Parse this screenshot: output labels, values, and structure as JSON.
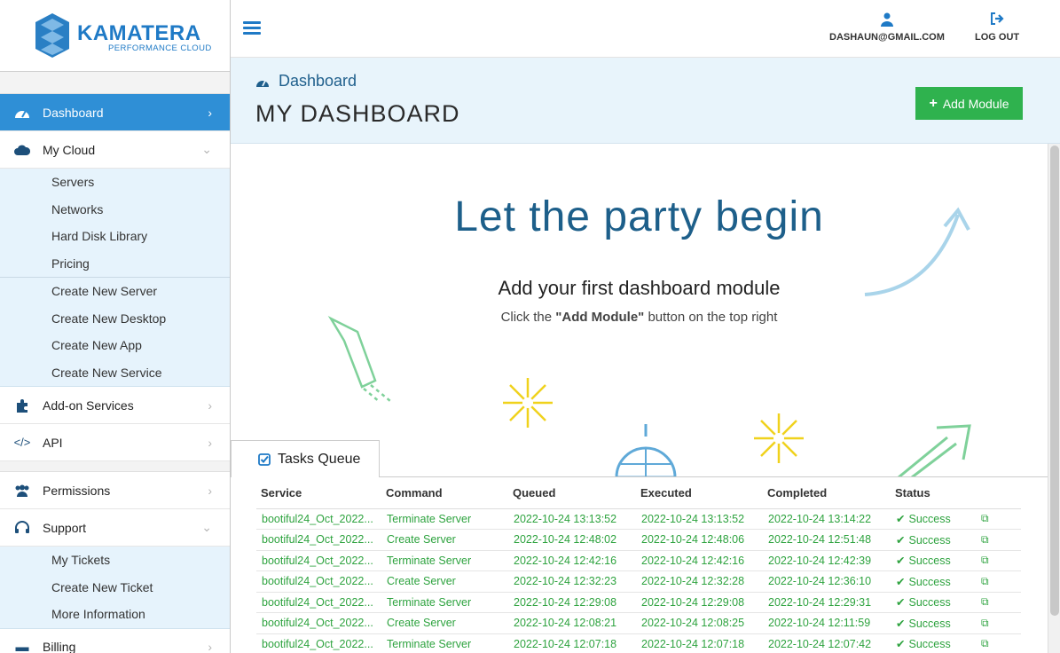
{
  "brand": {
    "name": "KAMATERA",
    "tagline": "PERFORMANCE CLOUD"
  },
  "topbar": {
    "user_email": "DASHAUN@GMAIL.COM",
    "logout_label": "LOG OUT"
  },
  "sidebar": {
    "dashboard": "Dashboard",
    "my_cloud": "My Cloud",
    "my_cloud_items": [
      "Servers",
      "Networks",
      "Hard Disk Library",
      "Pricing"
    ],
    "create_items": [
      "Create New Server",
      "Create New Desktop",
      "Create New App",
      "Create New Service"
    ],
    "addon": "Add-on Services",
    "api": "API",
    "permissions": "Permissions",
    "support": "Support",
    "support_items": [
      "My Tickets",
      "Create New Ticket",
      "More Information"
    ],
    "billing": "Billing"
  },
  "header": {
    "breadcrumb": "Dashboard",
    "title": "MY DASHBOARD",
    "add_module": "Add Module"
  },
  "hero": {
    "title": "Let the party begin",
    "subtitle": "Add your first dashboard module",
    "hint_pre": "Click the ",
    "hint_bold": "\"Add Module\"",
    "hint_post": " button on the top right"
  },
  "tasks": {
    "tab_label": "Tasks Queue",
    "columns": [
      "Service",
      "Command",
      "Queued",
      "Executed",
      "Completed",
      "Status"
    ],
    "rows": [
      [
        "bootiful24_Oct_2022...",
        "Terminate Server",
        "2022-10-24 13:13:52",
        "2022-10-24 13:13:52",
        "2022-10-24 13:14:22",
        "Success"
      ],
      [
        "bootiful24_Oct_2022...",
        "Create Server",
        "2022-10-24 12:48:02",
        "2022-10-24 12:48:06",
        "2022-10-24 12:51:48",
        "Success"
      ],
      [
        "bootiful24_Oct_2022...",
        "Terminate Server",
        "2022-10-24 12:42:16",
        "2022-10-24 12:42:16",
        "2022-10-24 12:42:39",
        "Success"
      ],
      [
        "bootiful24_Oct_2022...",
        "Create Server",
        "2022-10-24 12:32:23",
        "2022-10-24 12:32:28",
        "2022-10-24 12:36:10",
        "Success"
      ],
      [
        "bootiful24_Oct_2022...",
        "Terminate Server",
        "2022-10-24 12:29:08",
        "2022-10-24 12:29:08",
        "2022-10-24 12:29:31",
        "Success"
      ],
      [
        "bootiful24_Oct_2022...",
        "Create Server",
        "2022-10-24 12:08:21",
        "2022-10-24 12:08:25",
        "2022-10-24 12:11:59",
        "Success"
      ],
      [
        "bootiful24_Oct_2022...",
        "Terminate Server",
        "2022-10-24 12:07:18",
        "2022-10-24 12:07:18",
        "2022-10-24 12:07:42",
        "Success"
      ]
    ]
  },
  "colors": {
    "accent": "#2f8fd6",
    "brand": "#1f7ac6",
    "success": "#2ea33f",
    "header_bg": "#e8f4fb"
  }
}
